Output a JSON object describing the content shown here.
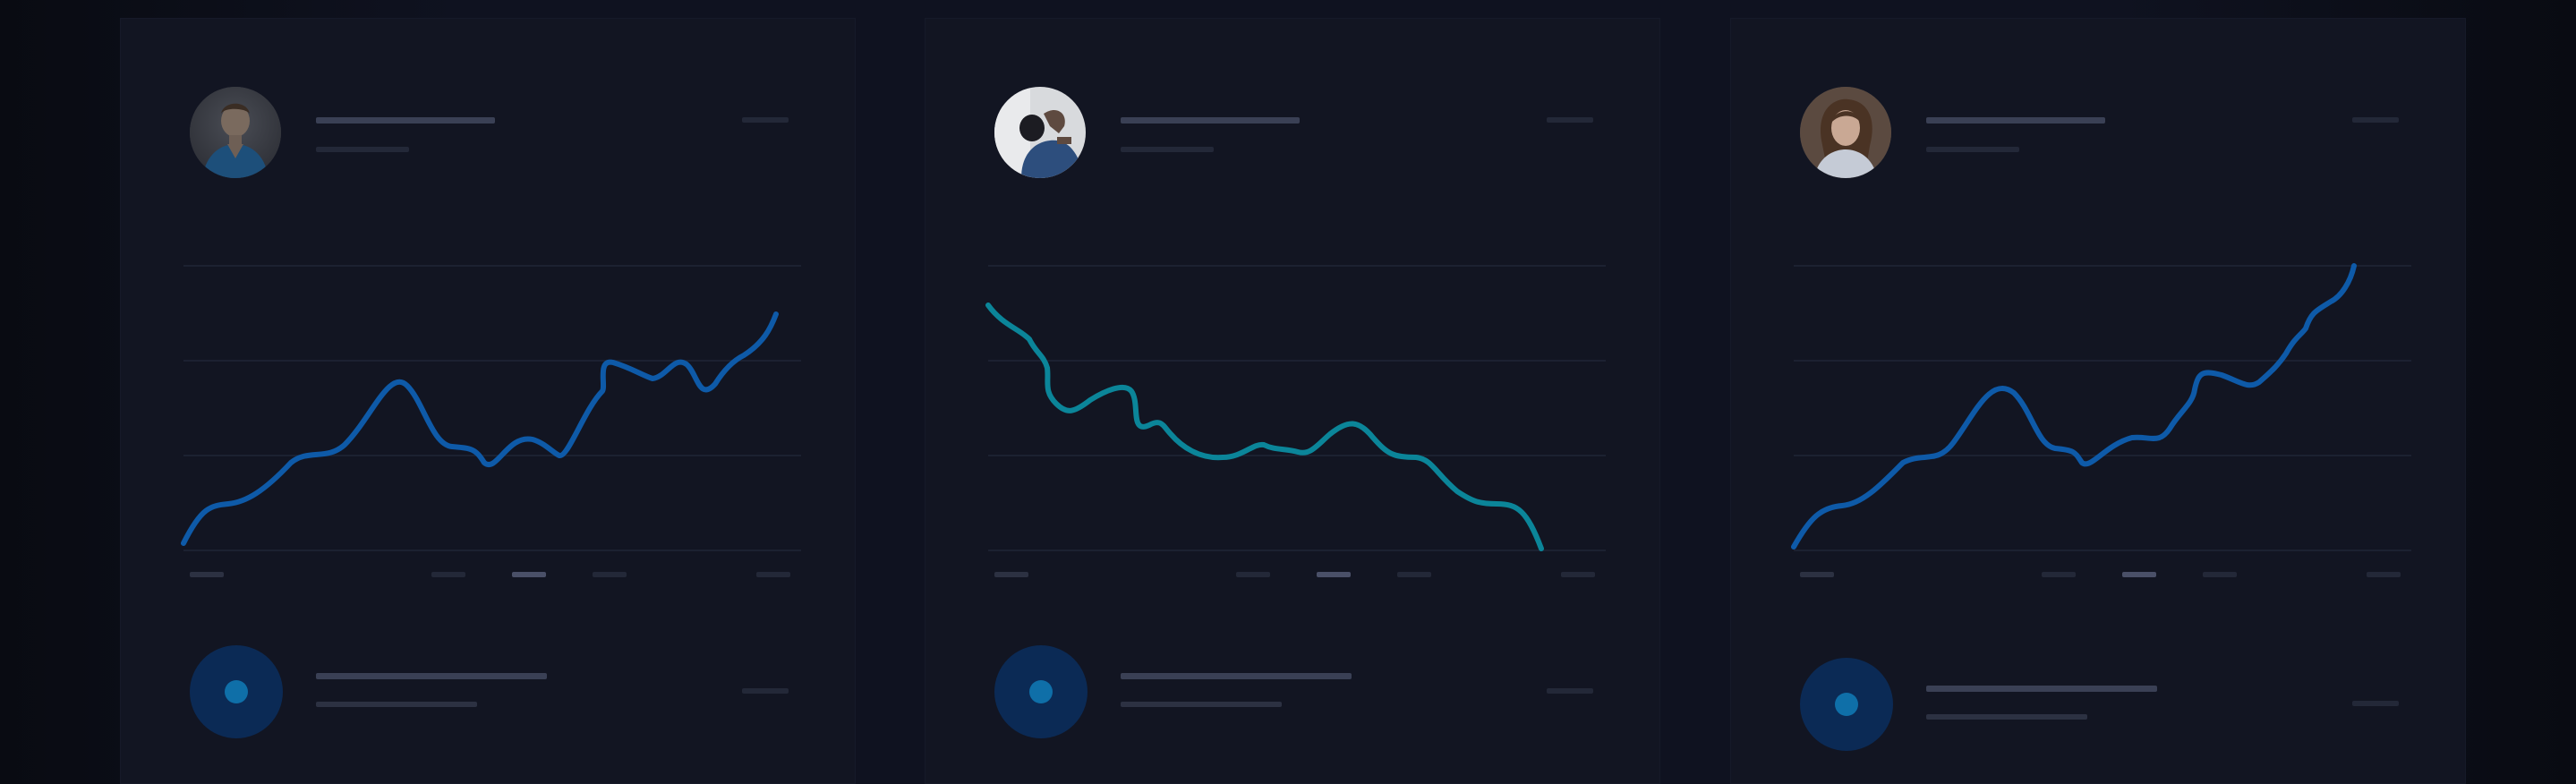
{
  "cards": [
    {
      "avatar": "avatar-portrait-man-blue-jacket",
      "line_color": "#0e5aa8"
    },
    {
      "avatar": "avatar-portrait-man-reclining",
      "line_color": "#0b8599"
    },
    {
      "avatar": "avatar-portrait-woman",
      "line_color": "#0e5aa8"
    }
  ],
  "colors": {
    "background": "#0b0e16",
    "card": "#121522",
    "skeleton": "#3a4055",
    "grid": "#1c2131",
    "dot_ring": "#0b2a55",
    "dot_center": "#0f6fa8"
  }
}
